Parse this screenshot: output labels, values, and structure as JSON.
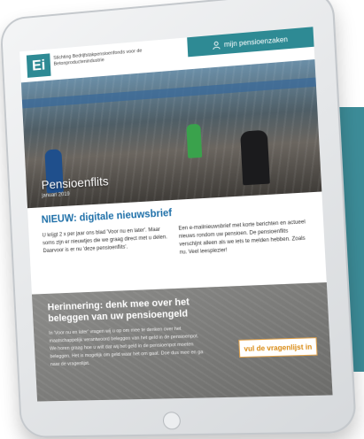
{
  "brand": {
    "logo_text": "Ei",
    "org_name": "Stichting Bedrijfstakpensioenfonds voor de Betonproductenindustrie"
  },
  "header": {
    "portal_label": "mijn pensioenzaken"
  },
  "hero": {
    "title": "Pensioenflits",
    "date": "januari 2019"
  },
  "article": {
    "heading": "NIEUW: digitale nieuwsbrief",
    "col1": "U krijgt 2 x per jaar ons blad 'Voor nu en later'. Maar soms zijn er nieuwtjes die we graag direct met u delen. Daarvoor is er nu 'deze pensioenflits'.",
    "col2": "Een e-mailnieuwsbrief met korte berichten en actueel nieuws rondom uw pensioen. De pensioenflits verschijnt alleen als we iets te melden hebben. Zoals nu. Veel leesplezier!"
  },
  "reminder": {
    "heading": "Herinnering: denk mee over het beleggen van uw pensioengeld",
    "body": "In 'Voor nu en later' vragen wij u op om mee te denken over het maatschappelijk verantwoord beleggen van het geld in de pensioenpot. We horen graag hoe u wilt dat wij het geld in de pensioenpot moeten beleggen. Het is mogelijk om geld waar het om gaat. Doe dus mee en ga naar de vragenlijst.",
    "cta_label": "vul de vragenlijst in"
  },
  "colors": {
    "accent_teal": "#2e8a94",
    "heading_blue": "#1d6fa8",
    "cta_orange": "#d98a12"
  },
  "icons": {
    "portal": "person-icon"
  }
}
